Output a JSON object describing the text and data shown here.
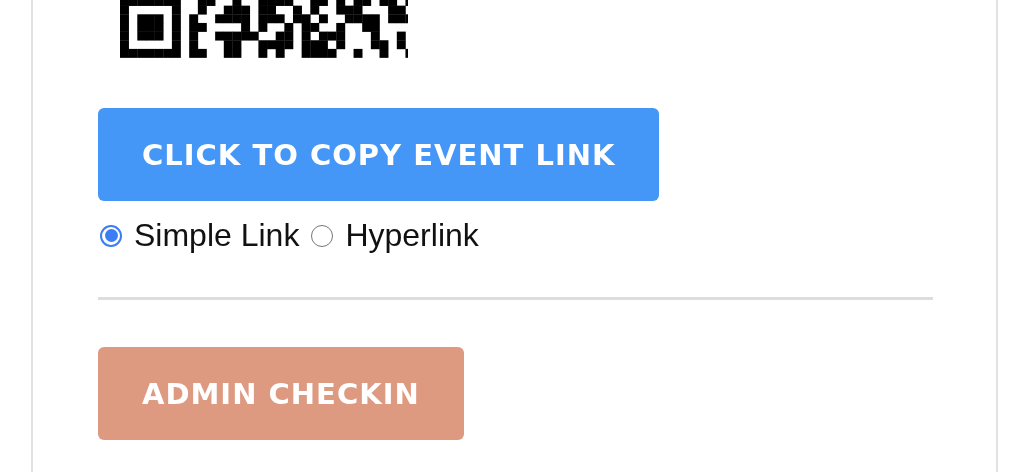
{
  "copy_button": {
    "label": "CLICK TO COPY EVENT LINK"
  },
  "link_type": [
    {
      "label": "Simple Link",
      "selected": true
    },
    {
      "label": "Hyperlink",
      "selected": false
    }
  ],
  "admin_button": {
    "label": "ADMIN CHECKIN"
  }
}
